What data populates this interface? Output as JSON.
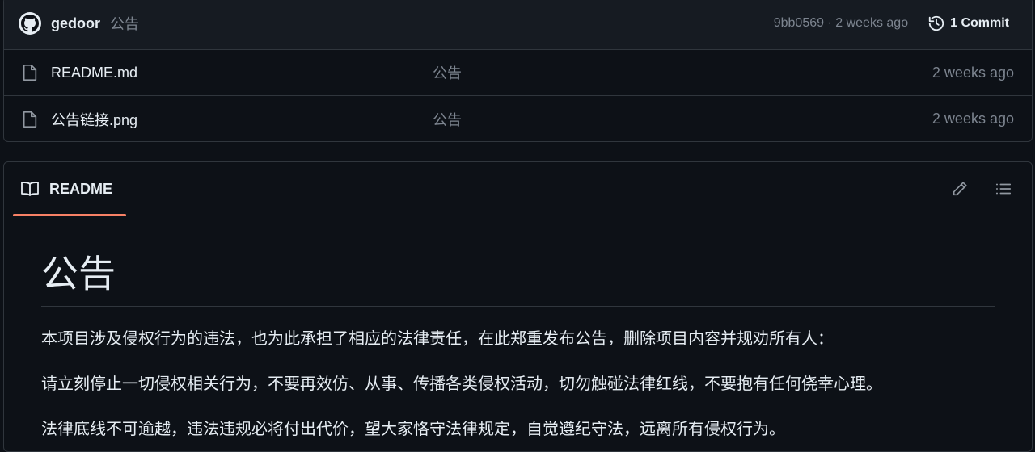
{
  "commit_bar": {
    "author": "gedoor",
    "message": "公告",
    "hash": "9bb0569",
    "separator": "·",
    "time": "2 weeks ago",
    "commits_label": "1 Commit"
  },
  "files": [
    {
      "name": "README.md",
      "commit_message": "公告",
      "time": "2 weeks ago",
      "icon": "file-icon"
    },
    {
      "name": "公告链接.png",
      "commit_message": "公告",
      "time": "2 weeks ago",
      "icon": "file-icon"
    }
  ],
  "readme": {
    "tab_label": "README",
    "title": "公告",
    "paragraphs": [
      "本项目涉及侵权行为的违法，也为此承担了相应的法律责任，在此郑重发布公告，删除项目内容并规劝所有人：",
      "请立刻停止一切侵权相关行为，不要再效仿、从事、传播各类侵权活动，切勿触碰法律红线，不要抱有任何侥幸心理。",
      "法律底线不可逾越，违法违规必将付出代价，望大家恪守法律规定，自觉遵纪守法，远离所有侵权行为。"
    ]
  },
  "colors": {
    "background": "#0d1117",
    "header_bg": "#161b22",
    "border": "#30363d",
    "muted": "#7d8590",
    "accent_underline": "#f78166"
  }
}
